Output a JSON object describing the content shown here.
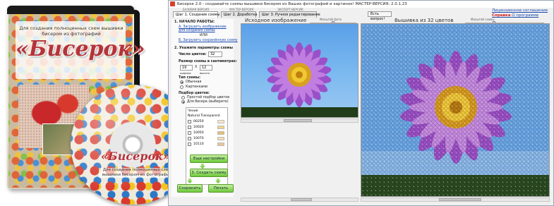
{
  "box": {
    "subtitle": "Для создания полноценных схем вышивки бисером из фотографий",
    "title": "«Бисерок»"
  },
  "cd": {
    "title": "«Бисерок»",
    "subtitle": "Для создания полноценных схем вышивки бисером из фотографий"
  },
  "window": {
    "title": "Бисерок 2.0 - создавайте схемы вышивки бисером из Ваших фотографий и картинок! МАСТЕР-ВЕРСИЯ: 2.0.1.23",
    "mini_labels": [
      "БАЗОВАЯ ВЕРСИЯ",
      "МАСТЕР-ВЕРСИЯ",
      "ЭКСПЕРТ-ВЕРСИЯ"
    ],
    "tabs": [
      "Шаг 1. Создание схемы",
      "Шаг 2. Доработка",
      "Шаг 3. Ручное редактирование"
    ],
    "help_button": "Есть вопрос!",
    "license": {
      "line1": "Лицензионное соглашение",
      "help": "Справка",
      "about": "О программе"
    }
  },
  "left_panel": {
    "step1_title": "1. НАЧАЛО РАБОТЫ:",
    "load_image_link": "А. Загрузить изображение для создания схемы",
    "or_text": "ИЛИ",
    "load_scheme_link": "Б. Загрузить сохранённую схему",
    "step2_title": "2. Укажите параметры схемы",
    "colors_label": "Число цветов:",
    "colors_value": "32",
    "size_label": "Размер схемы в сантиметрах:",
    "width_value": "19",
    "height_value": "12",
    "x_sep": "X",
    "width_caption": "ширина",
    "height_caption": "высота",
    "type_label": "Тип схемы:",
    "type_options": [
      "Обычная",
      "Картинками"
    ],
    "selection_label": "Подбор цветов:",
    "selection_options": [
      "Простой подбор цветов",
      "Для бисера (выберите)"
    ],
    "palette_header": "Чехия",
    "palette_items": [
      {
        "name": "Natural Transparent",
        "color": "#ffffff"
      },
      {
        "name": "00250",
        "color": "#f6e8c8"
      },
      {
        "name": "10020",
        "color": "#f0d48a"
      },
      {
        "name": "10050",
        "color": "#e6c070"
      },
      {
        "name": "10070",
        "color": "#f4dcb0"
      },
      {
        "name": "10110",
        "color": "#eac498"
      }
    ],
    "more_settings_button": "Еще настройки",
    "create_scheme_button": "3. Создать схему",
    "save_button": "Сохранить",
    "print_button": "Печать"
  },
  "original_panel": {
    "title": "Исходное изображение",
    "zoom_label": "Масштаб фото"
  },
  "bead_panel": {
    "title": "Вышивка из 32 цветов",
    "zoom_label": "Масштаб схемы"
  }
}
